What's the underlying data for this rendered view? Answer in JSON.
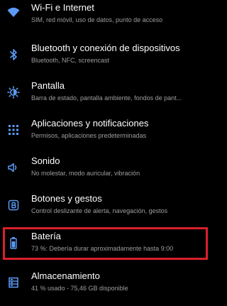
{
  "settings": {
    "items": [
      {
        "title": "Wi-Fi e Internet",
        "subtitle": "SIM, red móvil, uso de datos, punto de acceso",
        "icon": "wifi-icon"
      },
      {
        "title": "Bluetooth y conexión de dispositivos",
        "subtitle": "Bluetooth, NFC, screencast",
        "icon": "bluetooth-icon"
      },
      {
        "title": "Pantalla",
        "subtitle": "Barra de estado, pantalla ambiente, fondos de pant...",
        "icon": "brightness-icon"
      },
      {
        "title": "Aplicaciones y notificaciones",
        "subtitle": "Permisos, aplicaciones predeterminadas",
        "icon": "apps-grid-icon"
      },
      {
        "title": "Sonido",
        "subtitle": "No molestar, modo auricular, vibración",
        "icon": "speaker-icon"
      },
      {
        "title": "Botones y gestos",
        "subtitle": "Control deslizante de alerta, navegación, gestos",
        "icon": "button-b-icon"
      },
      {
        "title": "Batería",
        "subtitle": "73 %: Debería durar aproximadamente hasta 9:00",
        "icon": "battery-icon"
      },
      {
        "title": "Almacenamiento",
        "subtitle": "41 % usado - 75,46 GB disponible",
        "icon": "storage-icon"
      }
    ]
  },
  "colors": {
    "background": "#000000",
    "icon_blue": "#5b9bf5",
    "text_primary": "#ffffff",
    "text_secondary": "#9e9ea2",
    "highlight_red": "#d9202c"
  }
}
